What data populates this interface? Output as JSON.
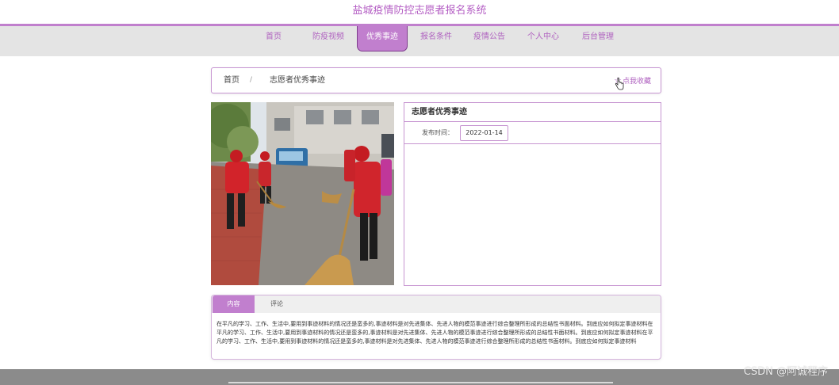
{
  "site": {
    "title": "盐城疫情防控志愿者报名系统"
  },
  "nav": {
    "items": [
      {
        "label": "首页",
        "active": false
      },
      {
        "label": "防疫视频",
        "active": false
      },
      {
        "label": "优秀事迹",
        "active": true
      },
      {
        "label": "报名条件",
        "active": false
      },
      {
        "label": "疫情公告",
        "active": false
      },
      {
        "label": "个人中心",
        "active": false
      },
      {
        "label": "后台管理",
        "active": false
      }
    ]
  },
  "breadcrumb": {
    "home": "首页",
    "separator": "/",
    "current": "志愿者优秀事迹",
    "favorite_label": "点我收藏",
    "favorite_icon": "star-outline-icon"
  },
  "detail": {
    "title": "志愿者优秀事迹",
    "publish_label": "发布时间：",
    "publish_date": "2022-01-14",
    "image_description": "volunteers-sweeping-street-photo"
  },
  "content": {
    "tabs": [
      {
        "label": "内容",
        "active": true
      },
      {
        "label": "评论",
        "active": false
      }
    ],
    "text": "在平凡的学习、工作、生活中,要用到事迹材料的情况还是蛮多的,事迹材料是对先进集体、先进人物的模范事迹进行综合整理所形成的总结性书面材料。到底应如何拟定事迹材料在平凡的学习、工作、生活中,要用到事迹材料的情况还是蛮多的,事迹材料是对先进集体、先进人物的模范事迹进行综合整理所形成的总结性书面材料。到底应如何拟定事迹材料在平凡的学习、工作、生活中,要用到事迹材料的情况还是蛮多的,事迹材料是对先进集体、先进人物的模范事迹进行综合整理所形成的总结性书面材料。到底应如何拟定事迹材料"
  },
  "watermark": {
    "text": "CSDN @阿诚程序"
  },
  "colors": {
    "accent": "#c17fce",
    "accent_text": "#b063c0",
    "nav_bg": "#e4e4e4",
    "border": "#c795d1"
  }
}
